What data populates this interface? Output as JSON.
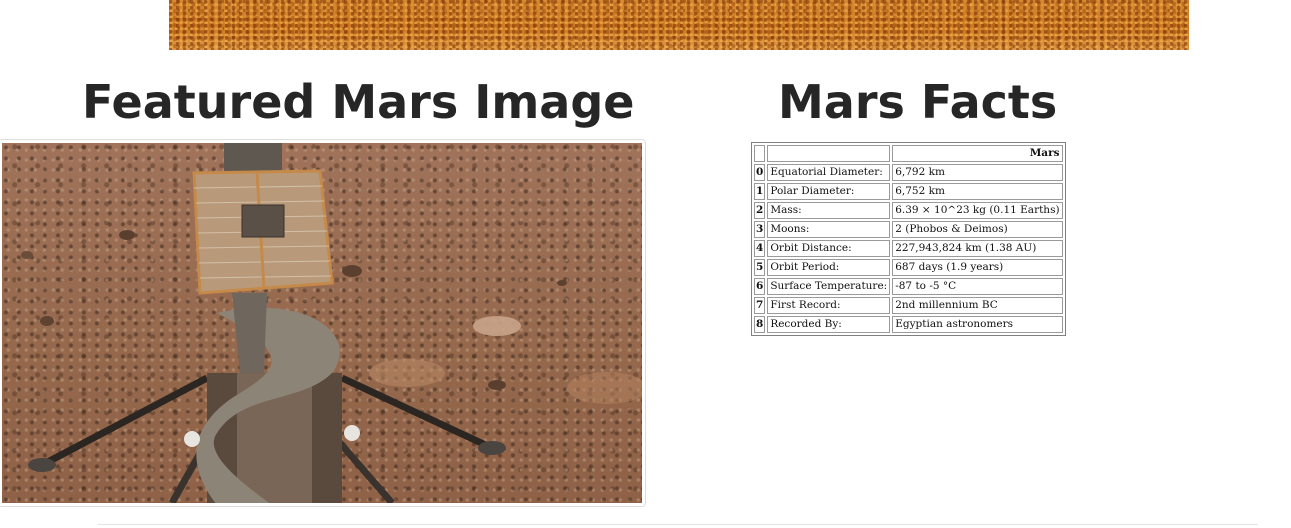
{
  "featured_image": {
    "heading": "Featured Mars Image"
  },
  "mars_facts": {
    "heading": "Mars Facts",
    "column_header": "Mars",
    "rows": [
      {
        "index": "0",
        "label": "Equatorial Diameter:",
        "value": "6,792 km"
      },
      {
        "index": "1",
        "label": "Polar Diameter:",
        "value": "6,752 km"
      },
      {
        "index": "2",
        "label": "Mass:",
        "value": "6.39 × 10^23 kg (0.11 Earths)"
      },
      {
        "index": "3",
        "label": "Moons:",
        "value": "2 (Phobos & Deimos)"
      },
      {
        "index": "4",
        "label": "Orbit Distance:",
        "value": "227,943,824 km (1.38 AU)"
      },
      {
        "index": "5",
        "label": "Orbit Period:",
        "value": "687 days (1.9 years)"
      },
      {
        "index": "6",
        "label": "Surface Temperature:",
        "value": "-87 to -5 °C"
      },
      {
        "index": "7",
        "label": "First Record:",
        "value": "2nd millennium BC"
      },
      {
        "index": "8",
        "label": "Recorded By:",
        "value": "Egyptian astronomers"
      }
    ]
  },
  "colors": {
    "heading_text": "#262626",
    "banner": "#d5822a",
    "mars_ground": "#9a6c4b"
  }
}
